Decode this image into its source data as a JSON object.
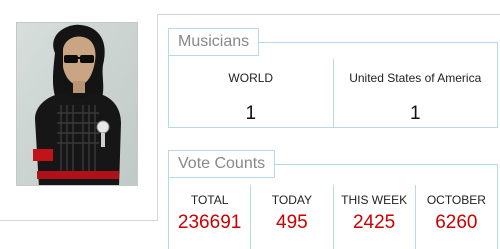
{
  "musicians": {
    "title": "Musicians",
    "columns": [
      {
        "label": "WORLD",
        "value": "1"
      },
      {
        "label": "United States of America",
        "value": "1"
      }
    ]
  },
  "votes": {
    "title": "Vote Counts",
    "columns": [
      {
        "label": "TOTAL",
        "value": "236691"
      },
      {
        "label": "TODAY",
        "value": "495"
      },
      {
        "label": "THIS WEEK",
        "value": "2425"
      },
      {
        "label": "OCTOBER",
        "value": "6260"
      }
    ],
    "value_color": "#cc0000"
  },
  "photo": {
    "icon": "musician-photo"
  }
}
